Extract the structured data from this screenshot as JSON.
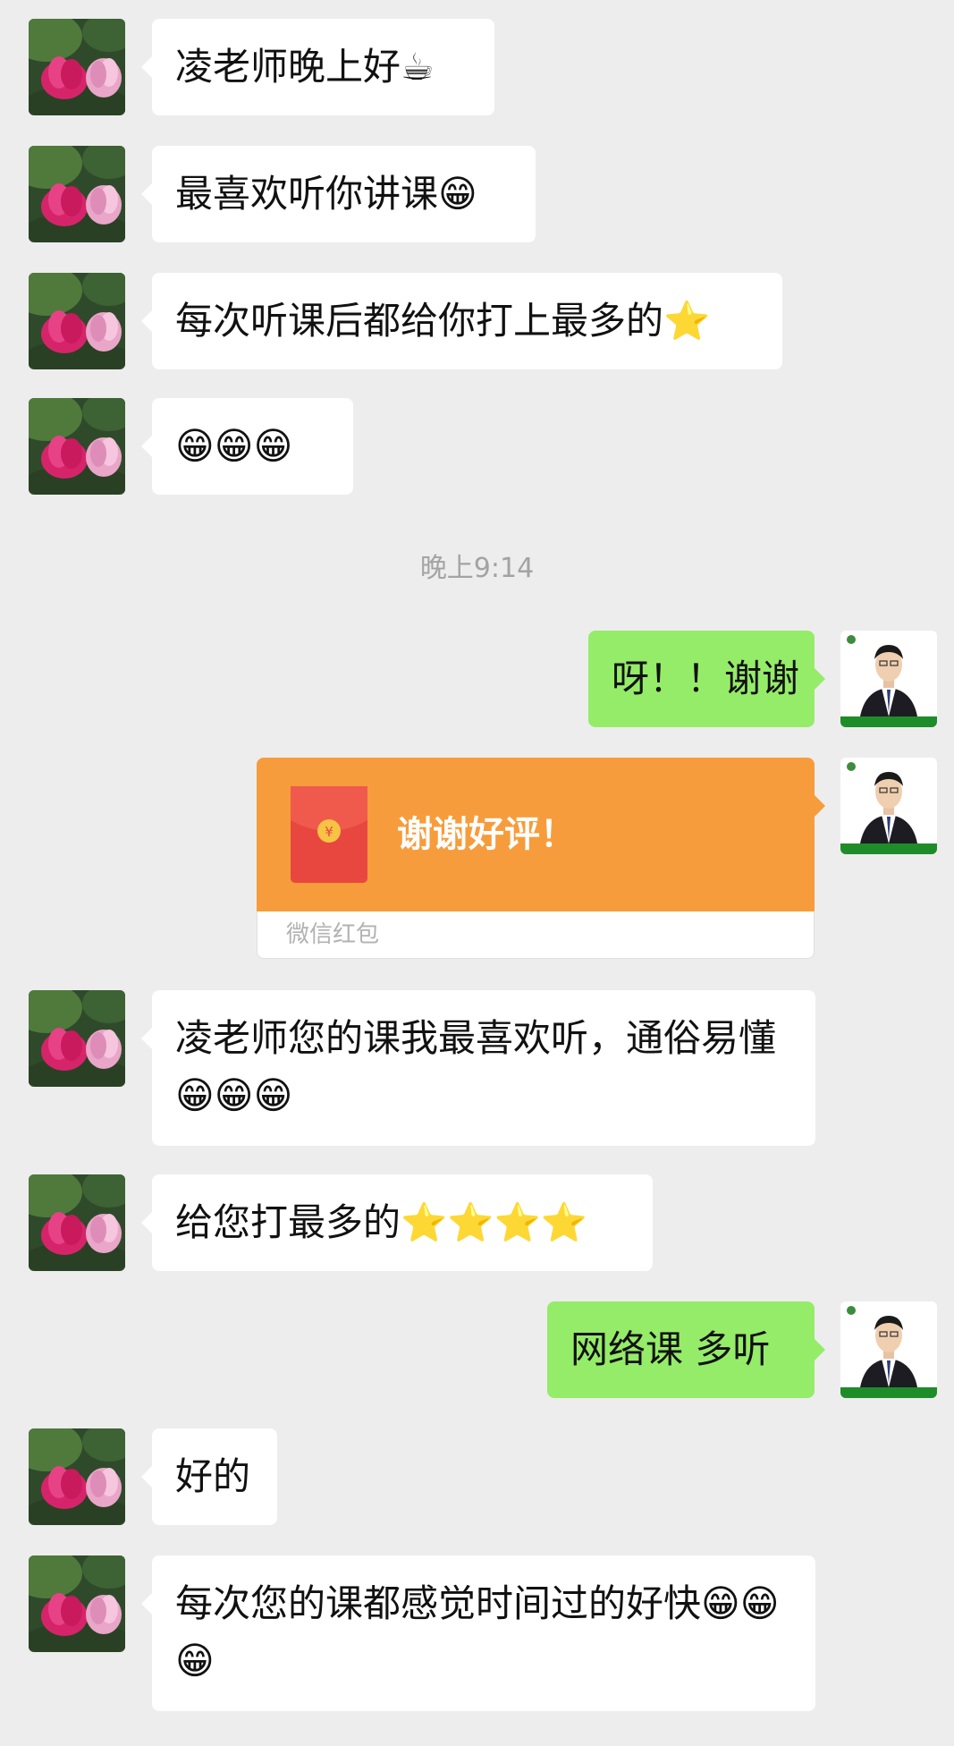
{
  "messages": {
    "m1": "凌老师晚上好☕",
    "m2": "最喜欢听你讲课😁",
    "m3": "每次听课后都给你打上最多的⭐",
    "m4": "😁😁😁",
    "timestamp": "晚上9:14",
    "m5": "呀！！谢谢",
    "redpacket_text": "谢谢好评！",
    "redpacket_label": "微信红包",
    "m6": "凌老师您的课我最喜欢听，通俗易懂😁😁😁",
    "m7": "给您打最多的⭐⭐⭐⭐",
    "m8": "网络课 多听",
    "m9": "好的",
    "m10": "每次您的课都感觉时间过的好快😁😁😁"
  },
  "colors": {
    "background": "#ededed",
    "incoming_bubble": "#ffffff",
    "outgoing_bubble": "#95ec69",
    "red_packet": "#f79c3c",
    "envelope": "#e8473f"
  },
  "icons": {
    "contact_avatar": "lotus-flower-avatar",
    "self_avatar": "man-in-suit-avatar",
    "red_packet": "red-envelope-icon"
  }
}
